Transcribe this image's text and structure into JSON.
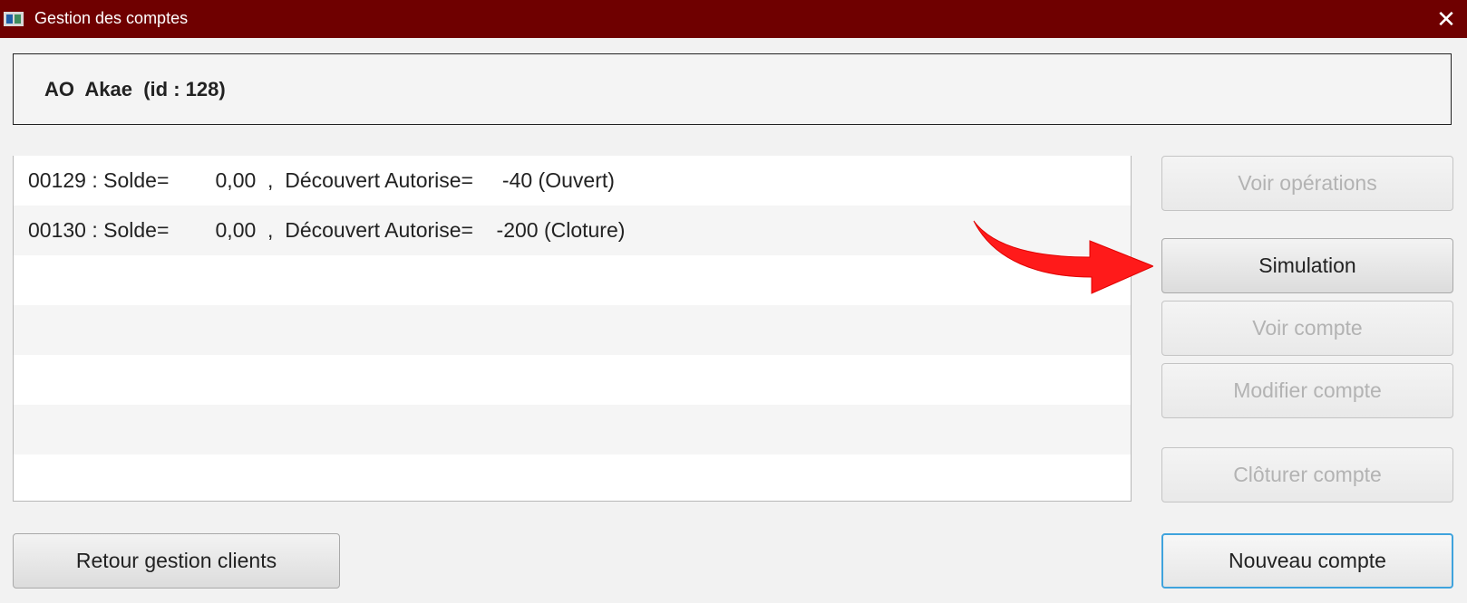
{
  "window": {
    "title": "Gestion des comptes",
    "icon": "app-window-icon",
    "close_symbol": "✕",
    "titlebar_color": "#6f0000"
  },
  "client": {
    "title": "AO  Akae  (id : 128)"
  },
  "accounts": [
    {
      "text": "00129 : Solde=        0,00  ,  Découvert Autorise=     -40 (Ouvert)"
    },
    {
      "text": "00130 : Solde=        0,00  ,  Découvert Autorise=    -200 (Cloture)"
    }
  ],
  "buttons": {
    "voir_operations": "Voir opérations",
    "simulation": "Simulation",
    "voir_compte": "Voir compte",
    "modifier_compte": "Modifier compte",
    "cloturer_compte": "Clôturer compte",
    "retour_gestion_clients": "Retour gestion clients",
    "nouveau_compte": "Nouveau compte"
  },
  "annotation": {
    "arrow_icon": "red-curved-arrow-icon",
    "arrow_color": "#ff1a1a"
  }
}
